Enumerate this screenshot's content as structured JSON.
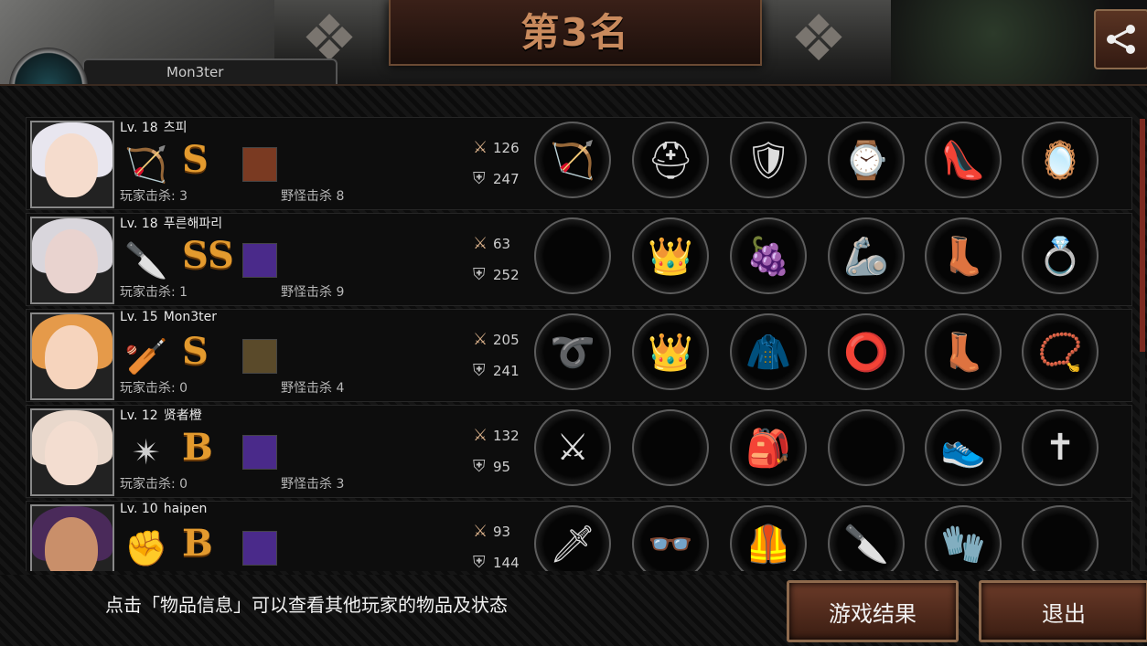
{
  "header": {
    "title": "第3名",
    "player_name": "Mon3ter"
  },
  "players": [
    {
      "level": "Lv. 18",
      "name": "츠피",
      "weapon_icon": "bow-icon",
      "grade": "S",
      "player_kills": "玩家击杀: 3",
      "monster_kills": "野怪击杀 8",
      "attack": "126",
      "defense": "247",
      "items": [
        "bow-icon",
        "helmet-icon",
        "armor-icon",
        "watch-icon",
        "heels-icon",
        "mirror-icon"
      ]
    },
    {
      "level": "Lv. 18",
      "name": "푸른해파리",
      "weapon_icon": "knife-icon",
      "grade": "SS",
      "player_kills": "玩家击杀: 1",
      "monster_kills": "野怪击杀 9",
      "attack": "63",
      "defense": "252",
      "items": [
        "",
        "tiara-icon",
        "grapes-icon",
        "claw-gauntlet-icon",
        "boots-icon",
        "earrings-icon"
      ]
    },
    {
      "level": "Lv. 15",
      "name": "Mon3ter",
      "weapon_icon": "bat-icon",
      "grade": "S",
      "player_kills": "玩家击杀: 0",
      "monster_kills": "野怪击杀 4",
      "attack": "205",
      "defense": "241",
      "items": [
        "whip-icon",
        "crown-icon",
        "jacket-icon",
        "bracelet-icon",
        "boots-icon",
        "necklace-icon"
      ]
    },
    {
      "level": "Lv. 12",
      "name": "贤者橙",
      "weapon_icon": "shuriken-icon",
      "grade": "B",
      "player_kills": "玩家击杀: 0",
      "monster_kills": "野怪击杀 3",
      "attack": "132",
      "defense": "95",
      "items": [
        "sword-icon",
        "",
        "backpack-icon",
        "",
        "sneakers-icon",
        "cross-icon"
      ]
    },
    {
      "level": "Lv. 10",
      "name": "haipen",
      "weapon_icon": "fist-icon",
      "grade": "B",
      "player_kills": "",
      "monster_kills": "",
      "attack": "93",
      "defense": "144",
      "items": [
        "claws-icon",
        "glasses-icon",
        "vest-icon",
        "blade-icon",
        "gauntlet-icon",
        ""
      ]
    }
  ],
  "footer": {
    "hint": "点击「物品信息」可以查看其他玩家的物品及状态",
    "result_button": "游戏结果",
    "exit_button": "退出"
  },
  "colors": {
    "grade": "#e39a2e",
    "button": "#6a3a28",
    "accent": "#c98a5d"
  }
}
